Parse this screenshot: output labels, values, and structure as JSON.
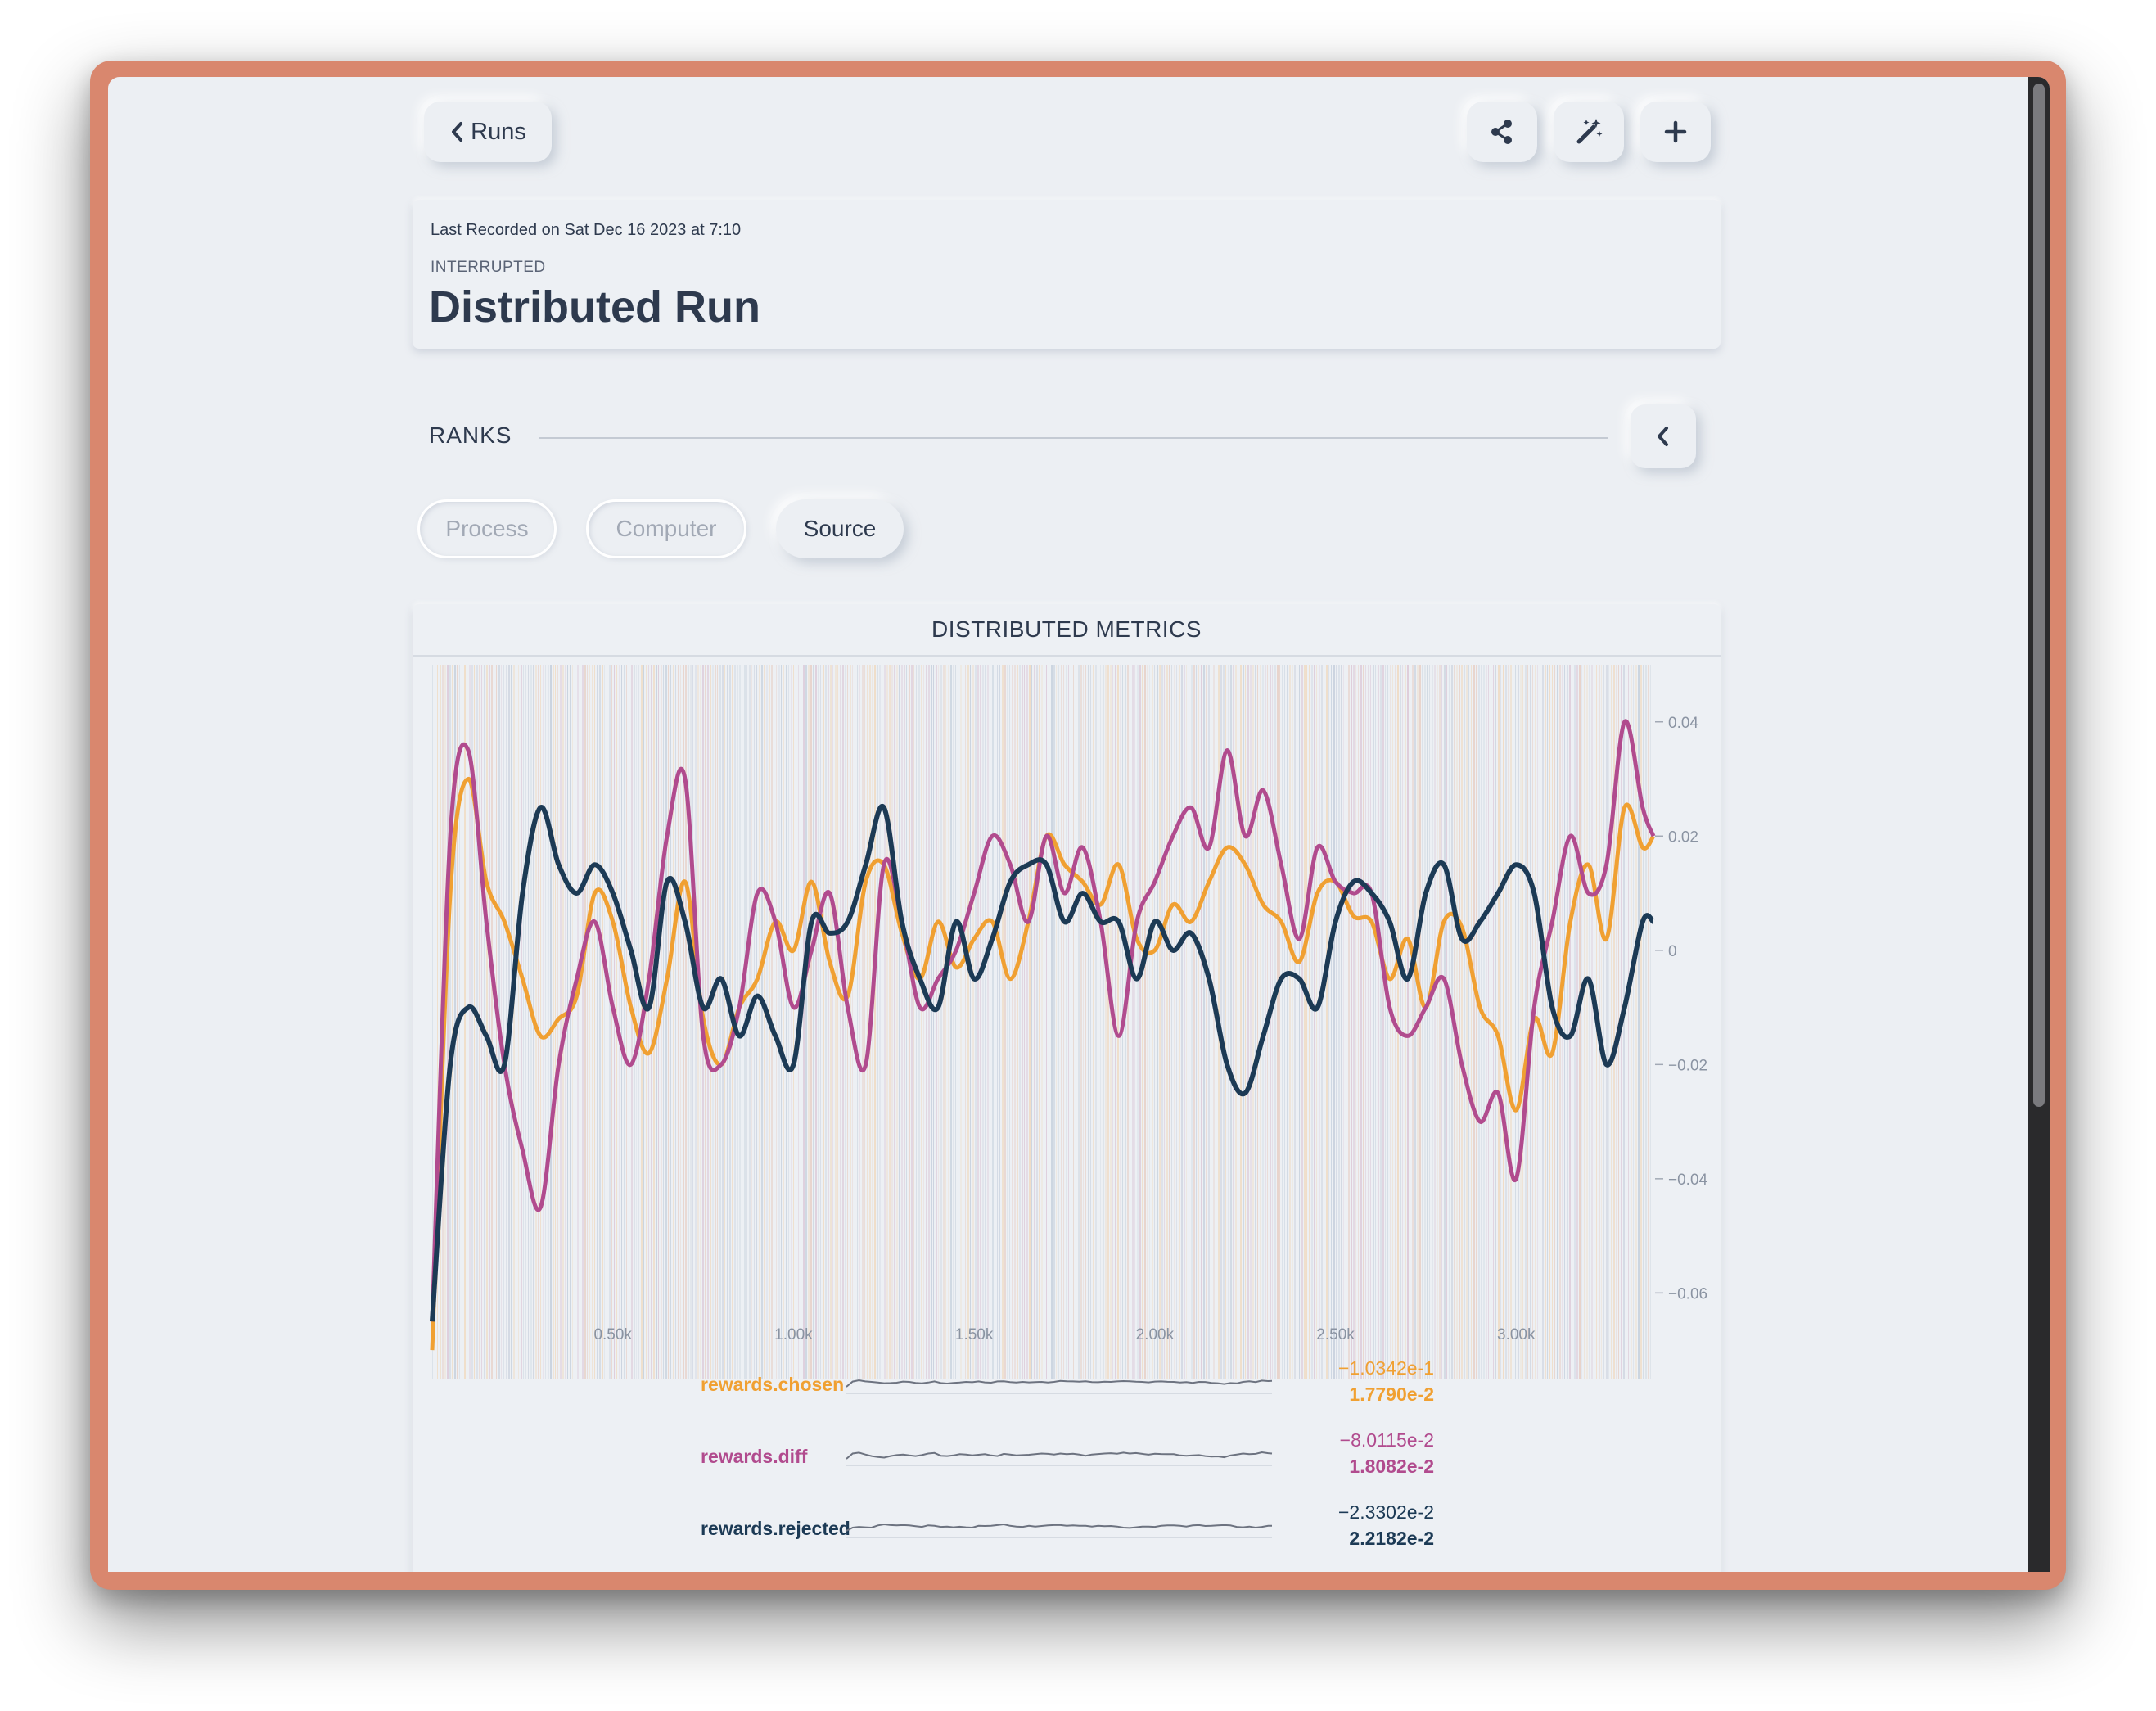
{
  "nav": {
    "back_label": "Runs",
    "icons": {
      "back": "chevron-left-icon",
      "share": "share-icon",
      "magic": "magic-wand-icon",
      "add": "plus-icon"
    }
  },
  "header": {
    "last_recorded": "Last Recorded on Sat Dec 16 2023 at 7:10",
    "status": "INTERRUPTED",
    "title": "Distributed Run"
  },
  "ranks": {
    "label": "RANKS",
    "collapse_icon": "chevron-left-icon"
  },
  "tabs": [
    {
      "label": "Process",
      "active": false
    },
    {
      "label": "Computer",
      "active": false
    },
    {
      "label": "Source",
      "active": true
    }
  ],
  "colors": {
    "orange": "#f0a032",
    "magenta": "#b14b8e",
    "navy": "#1c3a55",
    "text": "#2e3a4e"
  },
  "chart_data": {
    "type": "line",
    "title": "DISTRIBUTED METRICS",
    "xlim": [
      0,
      3380
    ],
    "ylim": [
      -0.075,
      0.05
    ],
    "x_ticks": [
      {
        "value": 500,
        "label": "0.50k"
      },
      {
        "value": 1000,
        "label": "1.00k"
      },
      {
        "value": 1500,
        "label": "1.50k"
      },
      {
        "value": 2000,
        "label": "2.00k"
      },
      {
        "value": 2500,
        "label": "2.50k"
      },
      {
        "value": 3000,
        "label": "3.00k"
      }
    ],
    "y_ticks": [
      {
        "value": 0.04,
        "label": "0.04"
      },
      {
        "value": 0.02,
        "label": "0.02"
      },
      {
        "value": 0,
        "label": "0"
      },
      {
        "value": -0.02,
        "label": "−0.02"
      },
      {
        "value": -0.04,
        "label": "−0.04"
      },
      {
        "value": -0.06,
        "label": "−0.06"
      }
    ],
    "series": [
      {
        "name": "rewards.chosen",
        "color": "#f0a032",
        "x": [
          0,
          50,
          100,
          150,
          200,
          250,
          300,
          350,
          400,
          450,
          500,
          550,
          600,
          650,
          700,
          750,
          800,
          850,
          900,
          950,
          1000,
          1050,
          1100,
          1150,
          1200,
          1250,
          1300,
          1350,
          1400,
          1450,
          1500,
          1550,
          1600,
          1650,
          1700,
          1750,
          1800,
          1850,
          1900,
          1950,
          2000,
          2050,
          2100,
          2150,
          2200,
          2250,
          2300,
          2350,
          2400,
          2450,
          2500,
          2550,
          2600,
          2650,
          2700,
          2750,
          2800,
          2850,
          2900,
          2950,
          3000,
          3050,
          3100,
          3150,
          3200,
          3250,
          3300,
          3350,
          3380
        ],
        "y": [
          -0.07,
          0.01,
          0.03,
          0.012,
          0.005,
          -0.005,
          -0.015,
          -0.012,
          -0.008,
          0.01,
          0.005,
          -0.01,
          -0.018,
          -0.005,
          0.012,
          -0.012,
          -0.02,
          -0.01,
          -0.005,
          0.005,
          0,
          0.012,
          -0.002,
          -0.008,
          0.012,
          0.015,
          0.003,
          -0.005,
          0.005,
          -0.003,
          0.002,
          0.005,
          -0.005,
          0.005,
          0.02,
          0.015,
          0.012,
          0.008,
          0.015,
          0.002,
          0,
          0.008,
          0.005,
          0.012,
          0.018,
          0.015,
          0.008,
          0.005,
          -0.002,
          0.01,
          0.012,
          0.006,
          0.005,
          -0.005,
          0.002,
          -0.01,
          0.005,
          0.004,
          -0.01,
          -0.015,
          -0.028,
          -0.012,
          -0.018,
          0.005,
          0.015,
          0.002,
          0.025,
          0.018,
          0.02
        ]
      },
      {
        "name": "rewards.diff",
        "color": "#b14b8e",
        "x": [
          0,
          50,
          100,
          150,
          200,
          250,
          300,
          350,
          400,
          450,
          500,
          550,
          600,
          650,
          700,
          750,
          800,
          850,
          900,
          950,
          1000,
          1050,
          1100,
          1150,
          1200,
          1250,
          1300,
          1350,
          1400,
          1450,
          1500,
          1550,
          1600,
          1650,
          1700,
          1750,
          1800,
          1850,
          1900,
          1950,
          2000,
          2050,
          2100,
          2150,
          2200,
          2250,
          2300,
          2350,
          2400,
          2450,
          2500,
          2550,
          2600,
          2650,
          2700,
          2750,
          2800,
          2850,
          2900,
          2950,
          3000,
          3050,
          3100,
          3150,
          3200,
          3250,
          3300,
          3350,
          3380
        ],
        "y": [
          -0.065,
          0.02,
          0.035,
          0.005,
          -0.02,
          -0.035,
          -0.045,
          -0.02,
          -0.005,
          0.005,
          -0.01,
          -0.02,
          -0.005,
          0.02,
          0.03,
          -0.015,
          -0.02,
          -0.01,
          0.01,
          0.005,
          -0.01,
          0,
          0.01,
          -0.01,
          -0.02,
          0.015,
          0.005,
          -0.01,
          -0.005,
          0,
          0.01,
          0.02,
          0.015,
          0.005,
          0.02,
          0.01,
          0.018,
          0.005,
          -0.015,
          0.005,
          0.012,
          0.02,
          0.025,
          0.018,
          0.035,
          0.02,
          0.028,
          0.015,
          0.002,
          0.018,
          0.012,
          0.01,
          0.01,
          -0.01,
          -0.015,
          -0.01,
          -0.005,
          -0.02,
          -0.03,
          -0.025,
          -0.04,
          -0.01,
          0.005,
          0.02,
          0.01,
          0.015,
          0.04,
          0.025,
          0.02
        ]
      },
      {
        "name": "rewards.rejected",
        "color": "#1c3a55",
        "x": [
          0,
          50,
          100,
          150,
          200,
          250,
          300,
          350,
          400,
          450,
          500,
          550,
          600,
          650,
          700,
          750,
          800,
          850,
          900,
          950,
          1000,
          1050,
          1100,
          1150,
          1200,
          1250,
          1300,
          1350,
          1400,
          1450,
          1500,
          1550,
          1600,
          1650,
          1700,
          1750,
          1800,
          1850,
          1900,
          1950,
          2000,
          2050,
          2100,
          2150,
          2200,
          2250,
          2300,
          2350,
          2400,
          2450,
          2500,
          2550,
          2600,
          2650,
          2700,
          2750,
          2800,
          2850,
          2900,
          2950,
          3000,
          3050,
          3100,
          3150,
          3200,
          3250,
          3300,
          3350,
          3380
        ],
        "y": [
          -0.065,
          -0.02,
          -0.01,
          -0.015,
          -0.02,
          0.01,
          0.025,
          0.015,
          0.01,
          0.015,
          0.01,
          0,
          -0.01,
          0.012,
          0.005,
          -0.01,
          -0.005,
          -0.015,
          -0.008,
          -0.015,
          -0.02,
          0.005,
          0.003,
          0.005,
          0.015,
          0.025,
          0.005,
          -0.005,
          -0.01,
          0.005,
          -0.005,
          0.002,
          0.012,
          0.015,
          0.015,
          0.005,
          0.01,
          0.005,
          0.005,
          -0.005,
          0.005,
          0,
          0.003,
          -0.005,
          -0.02,
          -0.025,
          -0.015,
          -0.005,
          -0.005,
          -0.01,
          0.005,
          0.012,
          0.01,
          0.005,
          -0.005,
          0.01,
          0.015,
          0.002,
          0.005,
          0.01,
          0.015,
          0.01,
          -0.01,
          -0.015,
          -0.005,
          -0.02,
          -0.01,
          0.005,
          0.005
        ]
      }
    ]
  },
  "legend": [
    {
      "name": "rewards.chosen",
      "min": "−1.0342e-1",
      "max": "1.7790e-2",
      "color": "#f0a032"
    },
    {
      "name": "rewards.diff",
      "min": "−8.0115e-2",
      "max": "1.8082e-2",
      "color": "#b14b8e"
    },
    {
      "name": "rewards.rejected",
      "min": "−2.3302e-2",
      "max": "2.2182e-2",
      "color": "#1c3a55"
    }
  ]
}
